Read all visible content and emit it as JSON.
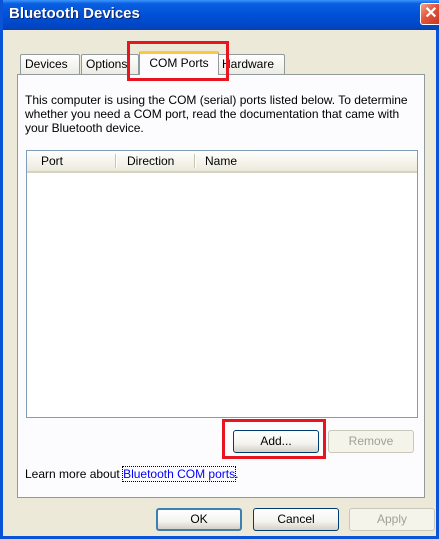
{
  "window": {
    "title": "Bluetooth Devices",
    "close_glyph": "✕"
  },
  "tabs": [
    {
      "label": "Devices"
    },
    {
      "label": "Options"
    },
    {
      "label": "COM Ports"
    },
    {
      "label": "Hardware"
    }
  ],
  "active_tab": "COM Ports",
  "description": "This computer is using the COM (serial) ports listed below. To determine whether you need a COM port, read the documentation that came with your Bluetooth device.",
  "ports_list": {
    "columns": [
      "Port",
      "Direction",
      "Name"
    ],
    "rows": []
  },
  "actions": {
    "add_label": "Add...",
    "remove_label": "Remove"
  },
  "learn_more": {
    "prefix": "Learn more about ",
    "link_text": "Bluetooth COM ports",
    "suffix": "."
  },
  "dialog_buttons": {
    "ok_label": "OK",
    "cancel_label": "Cancel",
    "apply_label": "Apply"
  },
  "colors": {
    "highlight": "#e8141f",
    "titlebar": "#0050d8",
    "active_tab_accent": "#ffc83c"
  }
}
